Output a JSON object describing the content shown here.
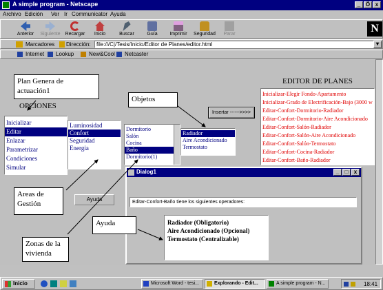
{
  "window": {
    "title": "A simple program - Netscape",
    "controls": [
      "_",
      "Õ",
      "x"
    ]
  },
  "menu": [
    "Archivo",
    "Edición",
    "Ver",
    "Ir",
    "Communicator",
    "Ayuda"
  ],
  "toolbar": {
    "buttons": [
      "Anterior",
      "Siguiente",
      "Recargar",
      "Inicio",
      "Buscar",
      "Guía",
      "Imprimir",
      "Seguridad",
      "Parar"
    ]
  },
  "location": {
    "bookmarks_label": "Marcadores",
    "address_label": "Dirección:",
    "url": "file:///C|/Tesis/Inicio/Editor de Planes/editor.html"
  },
  "personal": {
    "items": [
      "Internet",
      "Lookup",
      "New&Cool",
      "Netcaster"
    ]
  },
  "page": {
    "opciones_label": "OPCIONES",
    "opciones": [
      "Inicializar",
      "Editar",
      "Enlazar",
      "Parametrizar",
      "Condiciones",
      "Simular"
    ],
    "areas": [
      "Luminosidad",
      "Confort",
      "Seguridad",
      "Energia"
    ],
    "zonas": [
      "Dormitorio",
      "Salón",
      "Cocina",
      "Baño",
      "Dormitorio(1)"
    ],
    "objetos": [
      "Radiador",
      "Aire Acondicionado",
      "Termostato"
    ],
    "insert_button": "Insertar ------>>>>",
    "ayuda_button": "Ayuda",
    "editor_title": "EDITOR DE PLANES",
    "editor_lines": [
      "Inicializar-Elegir Fondo-Apartamento",
      "Inicializar-Grado de Electrificación-Bajo (3000 w",
      "Editar-Confort-Dormitorio-Radiador",
      "Editar-Confort-Dormitorio-Aire Acondicionado",
      "Editar-Confort-Salón-Radiador",
      "Editar-Confort-Salón-Aire Acondicionado",
      "Editar-Confort-Salón-Termostato",
      "Editar-Confort-Cocina-Radiador",
      "Editar-Confort-Baño-Radiador"
    ]
  },
  "dialog": {
    "title": "Dialog1",
    "message": "Editar-Confort-Baño tiene los siguientes operadores:",
    "operators": [
      "Radiador (Obligatorio)",
      "Aire Acondicionado (Opcional)",
      "Termostato (Centralizable)"
    ]
  },
  "callouts": {
    "plan": "Plan Genera de actuación1",
    "objetos": "Objetos",
    "areas": "Areas de Gestión",
    "ayuda": "Ayuda",
    "zonas": "Zonas de la vivienda"
  },
  "taskbar": {
    "start": "Inicio",
    "tasks": [
      "Microsoft Word - tesi...",
      "Explorando - Edit...",
      "A simple program - N..."
    ],
    "clock": "18:41"
  },
  "colors": {
    "title_bar": "#000080",
    "selection": "#000080",
    "plan_text": "#e00000",
    "desktop": "#008080"
  }
}
